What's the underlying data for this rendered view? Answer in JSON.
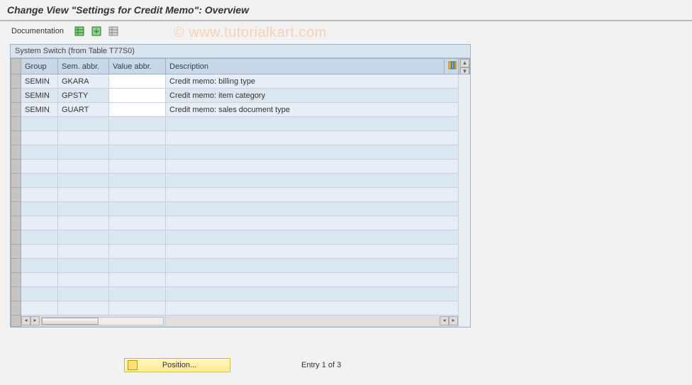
{
  "title": "Change View \"Settings for Credit Memo\": Overview",
  "toolbar": {
    "documentation": "Documentation"
  },
  "panel": {
    "title": "System Switch (from Table T77S0)"
  },
  "columns": {
    "group": "Group",
    "sem": "Sem. abbr.",
    "value": "Value abbr.",
    "desc": "Description"
  },
  "rows": [
    {
      "group": "SEMIN",
      "sem": "GKARA",
      "value": "",
      "desc": "Credit memo: billing type"
    },
    {
      "group": "SEMIN",
      "sem": "GPSTY",
      "value": "",
      "desc": "Credit memo: item category"
    },
    {
      "group": "SEMIN",
      "sem": "GUART",
      "value": "",
      "desc": "Credit memo: sales document type"
    }
  ],
  "footer": {
    "position": "Position...",
    "entry": "Entry 1 of 3"
  },
  "watermark": "© www.tutorialkart.com"
}
